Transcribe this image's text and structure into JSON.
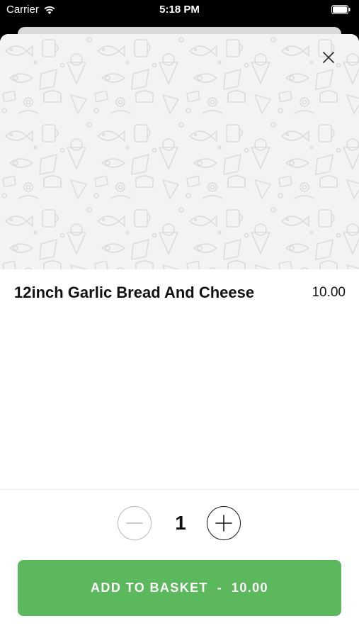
{
  "status_bar": {
    "carrier": "Carrier",
    "time": "5:18 PM"
  },
  "item": {
    "name": "12inch Garlic Bread And Cheese",
    "price": "10.00"
  },
  "quantity": {
    "value": "1"
  },
  "add_button": {
    "label": "ADD TO BASKET",
    "separator": "  -  ",
    "total": "10.00"
  },
  "colors": {
    "accent": "#5cb85c",
    "hero_background": "#f3f3f3",
    "sheet_background": "#ffffff"
  },
  "icons": {
    "close": "close-icon",
    "minus": "minus-icon",
    "plus": "plus-icon",
    "wifi": "wifi-icon",
    "battery": "battery-icon"
  }
}
